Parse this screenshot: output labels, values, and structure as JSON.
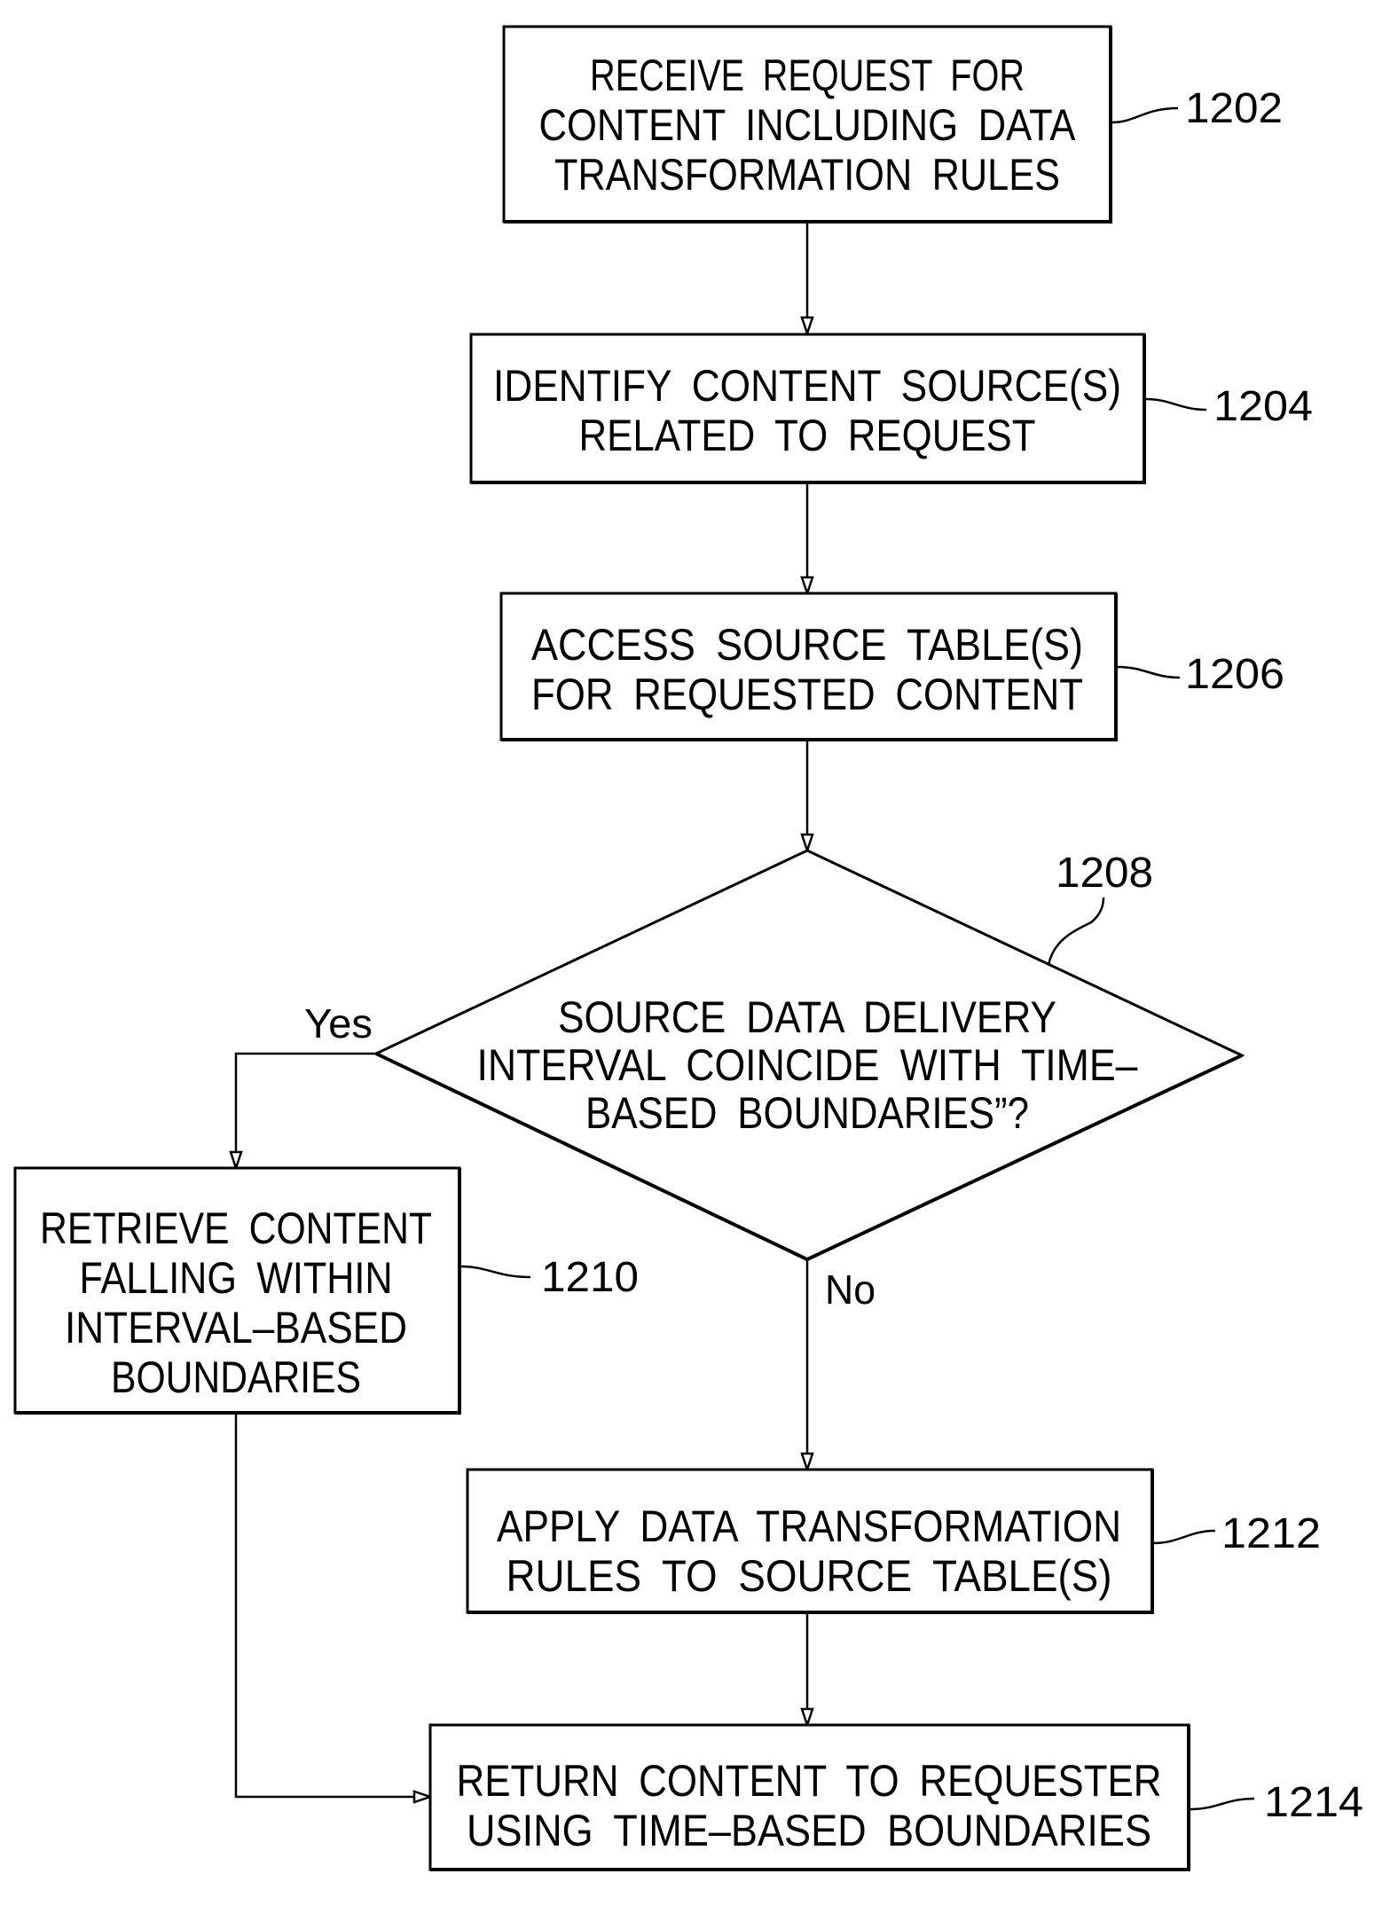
{
  "figure": {
    "type": "flowchart",
    "steps": [
      {
        "ref": "1202",
        "kind": "process",
        "lines": [
          "RECEIVE  REQUEST  FOR",
          "CONTENT  INCLUDING  DATA",
          "TRANSFORMATION  RULES"
        ]
      },
      {
        "ref": "1204",
        "kind": "process",
        "lines": [
          "IDENTIFY  CONTENT  SOURCE(S)",
          "RELATED  TO  REQUEST"
        ]
      },
      {
        "ref": "1206",
        "kind": "process",
        "lines": [
          "ACCESS  SOURCE  TABLE(S)",
          "FOR  REQUESTED  CONTENT"
        ]
      },
      {
        "ref": "1208",
        "kind": "decision",
        "lines": [
          "SOURCE  DATA  DELIVERY",
          "INTERVAL  COINCIDE  WITH  TIME–",
          "BASED  BOUNDARIES”?"
        ]
      },
      {
        "ref": "1210",
        "kind": "process",
        "lines": [
          "RETRIEVE  CONTENT",
          "FALLING  WITHIN",
          "INTERVAL–BASED",
          "BOUNDARIES"
        ]
      },
      {
        "ref": "1212",
        "kind": "process",
        "lines": [
          "APPLY  DATA  TRANSFORMATION",
          "RULES  TO  SOURCE  TABLE(S)"
        ]
      },
      {
        "ref": "1214",
        "kind": "process",
        "lines": [
          "RETURN  CONTENT  TO  REQUESTER",
          "USING  TIME–BASED  BOUNDARIES"
        ]
      }
    ],
    "edges": [
      {
        "from": "1202",
        "to": "1204",
        "label": ""
      },
      {
        "from": "1204",
        "to": "1206",
        "label": ""
      },
      {
        "from": "1206",
        "to": "1208",
        "label": ""
      },
      {
        "from": "1208",
        "to": "1210",
        "label": "Yes"
      },
      {
        "from": "1208",
        "to": "1212",
        "label": "No"
      },
      {
        "from": "1212",
        "to": "1214",
        "label": ""
      },
      {
        "from": "1210",
        "to": "1214",
        "label": ""
      }
    ],
    "branch_labels": {
      "yes": "Yes",
      "no": "No"
    }
  }
}
